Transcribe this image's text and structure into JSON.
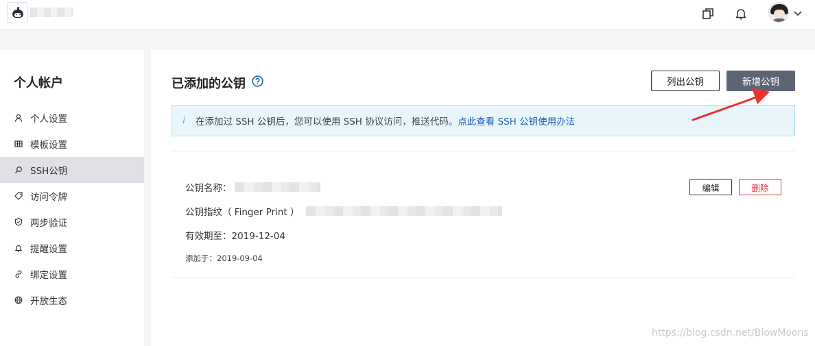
{
  "header": {
    "org_name": "",
    "icons": [
      "window-icon",
      "bell-icon",
      "avatar",
      "chevron-down-icon"
    ]
  },
  "sidebar": {
    "title": "个人帐户",
    "items": [
      {
        "label": "个人设置",
        "icon": "user-icon"
      },
      {
        "label": "模板设置",
        "icon": "grid-icon"
      },
      {
        "label": "SSH公钥",
        "icon": "key-search-icon",
        "active": true
      },
      {
        "label": "访问令牌",
        "icon": "tag-icon"
      },
      {
        "label": "两步验证",
        "icon": "shield-icon"
      },
      {
        "label": "提醒设置",
        "icon": "bell-icon"
      },
      {
        "label": "绑定设置",
        "icon": "link-icon"
      },
      {
        "label": "开放生态",
        "icon": "globe-icon"
      }
    ]
  },
  "main": {
    "title": "已添加的公钥",
    "list_button": "列出公钥",
    "add_button": "新增公钥",
    "info": {
      "text": "在添加过 SSH 公钥后，您可以使用 SSH 协议访问，推送代码。",
      "link": "点此查看 SSH 公钥使用办法"
    },
    "key": {
      "name_label": "公钥名称：",
      "fingerprint_label": "公钥指纹（ Finger Print ）",
      "expiry": "有效期至：2019-12-04",
      "added": "添加于：2019-09-04",
      "edit_button": "编辑",
      "delete_button": "删除"
    }
  },
  "watermark": "https://blog.csdn.net/BlowMoons",
  "colors": {
    "primary_button": "#5d6575",
    "info_bg": "#e8f6fc",
    "info_border": "#a9dff2",
    "link": "#1d5fb0",
    "danger": "#e0303a",
    "annotation_arrow": "#e8332e"
  }
}
